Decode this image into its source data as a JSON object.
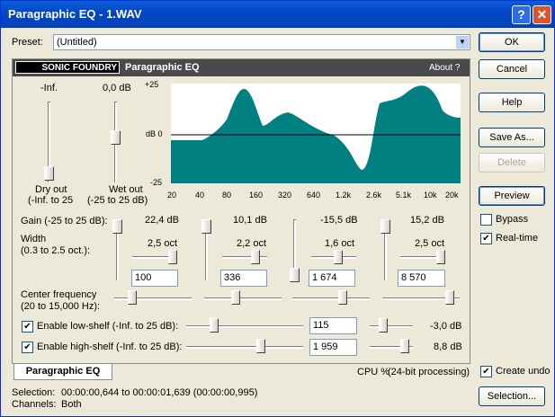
{
  "window": {
    "title": "Paragraphic EQ - 1.WAV",
    "help_glyph": "?",
    "close_glyph": "✕"
  },
  "preset": {
    "label": "Preset:",
    "value": "(Untitled)"
  },
  "buttons": {
    "ok": "OK",
    "cancel": "Cancel",
    "help": "Help",
    "save_as": "Save As...",
    "delete": "Delete",
    "preview": "Preview",
    "selection": "Selection..."
  },
  "options": {
    "bypass": "Bypass",
    "bypass_checked": false,
    "realtime": "Real-time",
    "realtime_checked": true,
    "create_undo": "Create undo",
    "create_undo_checked": true
  },
  "plugin": {
    "brand": "SONIC FOUNDRY",
    "name": "Paragraphic EQ",
    "about": "About  ?"
  },
  "output": {
    "dry_value": "-Inf.",
    "wet_value": "0,0 dB",
    "dry_label": "Dry out",
    "dry_range": "(-Inf. to 25",
    "wet_label": "Wet out",
    "wet_range": "(-25 to 25 dB)"
  },
  "graph": {
    "y_top": "+25",
    "y_mid": "dB 0",
    "y_bottom": "-25",
    "x_ticks": [
      "20",
      "40",
      "80",
      "160",
      "320",
      "640",
      "1.2k",
      "2.6k",
      "5.1k",
      "10k",
      "20k"
    ]
  },
  "bands": {
    "gain_label": "Gain (-25 to 25 dB):",
    "width_label": "Width",
    "width_range": "(0.3 to 2.5 oct.):",
    "center_label": "Center frequency",
    "center_range": "(20 to 15,000 Hz):",
    "gains": [
      "22,4 dB",
      "10,1 dB",
      "-15,5 dB",
      "15,2 dB"
    ],
    "widths": [
      "2,5 oct",
      "2,2 oct",
      "1,6 oct",
      "2,5 oct"
    ],
    "freqs": [
      "100",
      "336",
      "1 674",
      "8 570"
    ]
  },
  "shelves": {
    "low_label": "Enable low-shelf (-Inf. to 25 dB):",
    "low_checked": true,
    "low_freq": "115",
    "low_gain": "-3,0 dB",
    "high_label": "Enable high-shelf (-Inf. to 25 dB):",
    "high_checked": true,
    "high_freq": "1 959",
    "high_gain": "8,8 dB"
  },
  "tab": "Paragraphic EQ",
  "cpu": {
    "label": "CPU %",
    "processing": "(24-bit processing)"
  },
  "status": {
    "selection_label": "Selection:",
    "selection_value": "00:00:00,644 to 00:00:01,639 (00:00:00,995)",
    "channels_label": "Channels:",
    "channels_value": "Both"
  },
  "colors": {
    "curve_fill": "#008080",
    "banner": "#4a4a4a",
    "title_bar": "#0347c7"
  }
}
